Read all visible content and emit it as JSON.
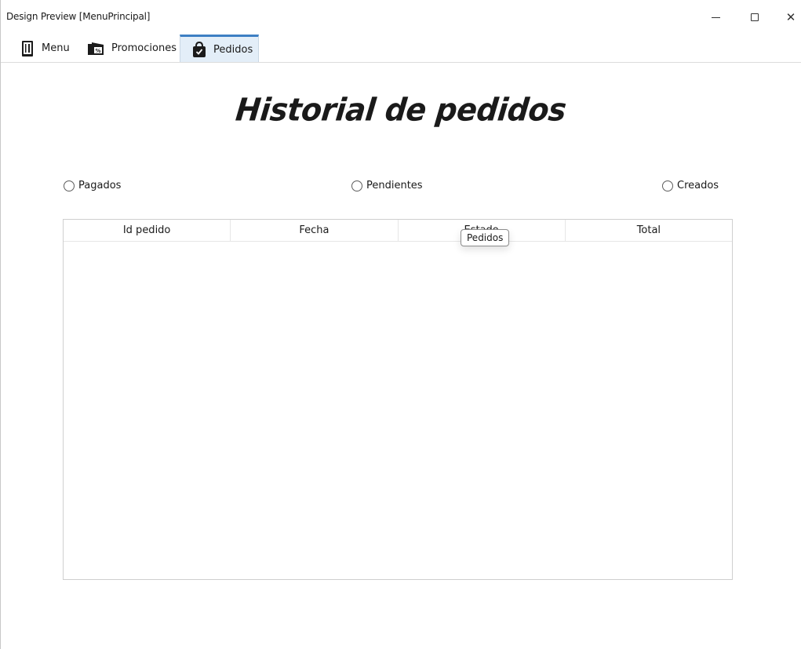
{
  "window": {
    "title": "Design Preview [MenuPrincipal]",
    "minimize_icon": "minimize-icon",
    "maximize_icon": "maximize-icon",
    "close_icon": "close-icon",
    "close_glyph": "✕"
  },
  "tabs": [
    {
      "label": "Menu",
      "icon": "menu-book-icon",
      "active": false
    },
    {
      "label": "Promociones",
      "icon": "percent-tag-icon",
      "active": false
    },
    {
      "label": "Pedidos",
      "icon": "shopping-bag-icon",
      "active": true
    }
  ],
  "main": {
    "heading": "Historial de pedidos",
    "filters": [
      {
        "label": "Pagados",
        "checked": false
      },
      {
        "label": "Pendientes",
        "checked": false
      },
      {
        "label": "Creados",
        "checked": false
      }
    ],
    "table": {
      "columns": [
        "Id pedido",
        "Fecha",
        "Estado",
        "Total"
      ],
      "rows": []
    },
    "tooltip": "Pedidos"
  },
  "colors": {
    "active_tab_border": "#3d7fc3",
    "active_tab_bg": "#e3eef8"
  }
}
